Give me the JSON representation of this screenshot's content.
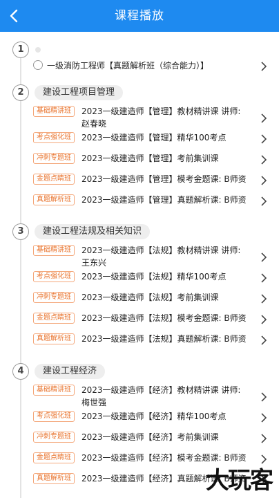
{
  "header": {
    "title": "课程播放",
    "back_icon": "chevron-left-icon"
  },
  "top": {
    "number": "1",
    "item": "一级消防工程师【真题解析班（综合能力）】"
  },
  "sections": [
    {
      "number": "2",
      "title": "建设工程项目管理",
      "items": [
        {
          "badge": "基础精讲班",
          "line1": "2023一级建造师【管理】教材精讲课 讲师:",
          "line2": "赵春晓"
        },
        {
          "badge": "考点强化班",
          "line1": "2023一级建造师【管理】精华100考点",
          "line2": ""
        },
        {
          "badge": "冲刺专题班",
          "line1": "2023一级建造师【管理】考前集训课",
          "line2": ""
        },
        {
          "badge": "金题点睛班",
          "line1": "2023一级建造师【管理】模考金题课: B师资",
          "line2": ""
        },
        {
          "badge": "真题解析班",
          "line1": "2023一级建造师【管理】真题解析课: B师资",
          "line2": ""
        }
      ]
    },
    {
      "number": "3",
      "title": "建设工程法规及相关知识",
      "items": [
        {
          "badge": "基础精讲班",
          "line1": "2023一级建造师【法规】教材精讲课 讲师:",
          "line2": "王东兴"
        },
        {
          "badge": "考点强化班",
          "line1": "2023一级建造师【法规】精华100考点",
          "line2": ""
        },
        {
          "badge": "冲刺专题班",
          "line1": "2023一级建造师【法规】考前集训课",
          "line2": ""
        },
        {
          "badge": "金题点睛班",
          "line1": "2023一级建造师【法规】模考金题课: B师资",
          "line2": ""
        },
        {
          "badge": "真题解析班",
          "line1": "2023一级建造师【法规】真题解析课: B师资",
          "line2": ""
        }
      ]
    },
    {
      "number": "4",
      "title": "建设工程经济",
      "items": [
        {
          "badge": "基础精讲班",
          "line1": "2023一级建造师【经济】教材精讲课 讲师:",
          "line2": "梅世强"
        },
        {
          "badge": "考点强化班",
          "line1": "2023一级建造师【经济】精华100考点",
          "line2": ""
        },
        {
          "badge": "冲刺专题班",
          "line1": "2023一级建造师【经济】考前集训课",
          "line2": ""
        },
        {
          "badge": "金题点睛班",
          "line1": "2023一级建造师【经济】模考金题课: B师资",
          "line2": ""
        },
        {
          "badge": "真题解析班",
          "line1": "2023一级建造师【经济】真题解析课: B师资",
          "line2": ""
        }
      ]
    }
  ],
  "watermark": "大玩客",
  "colors": {
    "header": "#1e8af0",
    "badge": "#e9742e"
  }
}
